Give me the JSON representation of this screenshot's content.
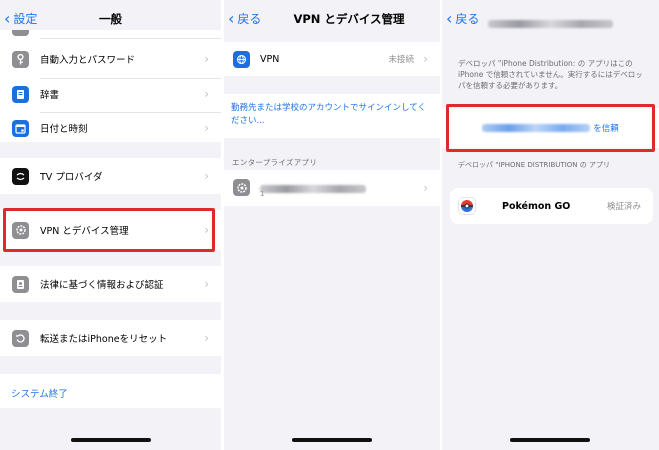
{
  "screen1": {
    "back_label": "設定",
    "title": "一般",
    "items": [
      {
        "label": "自動入力とパスワード",
        "icon": "key-icon"
      },
      {
        "label": "辞書",
        "icon": "dictionary-icon"
      },
      {
        "label": "日付と時刻",
        "icon": "calendar-icon"
      },
      {
        "label": "TV プロバイダ",
        "icon": "tv-provider-icon"
      },
      {
        "label": "VPN とデバイス管理",
        "icon": "gear-icon"
      },
      {
        "label": "法律に基づく情報および認証",
        "icon": "certificate-icon"
      },
      {
        "label": "転送またはiPhoneをリセット",
        "icon": "reset-icon"
      }
    ],
    "shutdown_label": "システム終了"
  },
  "screen2": {
    "back_label": "戻る",
    "title": "VPN とデバイス管理",
    "vpn": {
      "label": "VPN",
      "status": "未接続"
    },
    "signin_text": "勤務先または学校のアカウントでサインインしてください...",
    "enterprise_header": "エンタープライズアプリ",
    "enterprise_app_sub": "1"
  },
  "screen3": {
    "back_label": "戻る",
    "developer_message": "デベロッパ \"iPhone Distribution: の アプリはこの iPhone で信頼されていません。実行するにはデベロッパを信頼する必要があります。",
    "trust_suffix": "を信頼",
    "apps_header": "デベロッパ \"IPHONE DISTRIBUTION の アプリ",
    "app": {
      "name": "Pokémon GO",
      "status": "検証済み"
    }
  },
  "colors": {
    "accent": "#1d74e8",
    "highlight": "#e02a2a"
  }
}
